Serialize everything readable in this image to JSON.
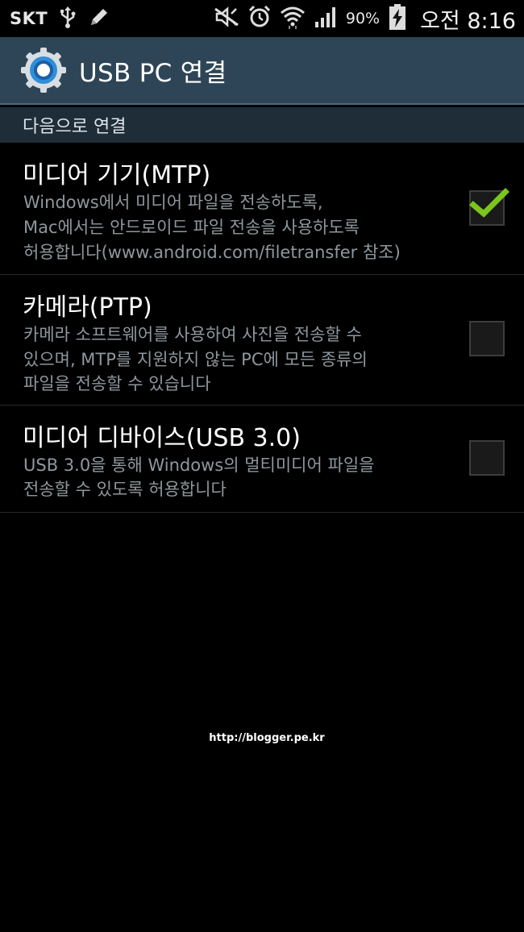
{
  "status_bar": {
    "carrier": "SKT",
    "battery_percent": "90%",
    "time": "오전 8:16",
    "icons": [
      "usb-icon",
      "pen-icon",
      "mute-icon",
      "alarm-icon",
      "wifi-icon",
      "signal-icon",
      "battery-charging-icon"
    ]
  },
  "action_bar": {
    "title": "USB PC 연결",
    "icon": "settings-gear-icon"
  },
  "section": {
    "header": "다음으로 연결"
  },
  "options": [
    {
      "title": "미디어 기기(MTP)",
      "description": [
        "Windows에서 미디어 파일을 전송하도록,",
        "Mac에서는 안드로이드 파일 전송을 사용하도록",
        "허용합니다(www.android.com/filetransfer 참조)"
      ],
      "checked": true
    },
    {
      "title": "카메라(PTP)",
      "description": [
        "카메라 소프트웨어를 사용하여 사진을 전송할 수",
        "있으며, MTP를 지원하지 않는 PC에 모든 종류의",
        "파일을 전송할 수 있습니다"
      ],
      "checked": false
    },
    {
      "title": "미디어 디바이스(USB 3.0)",
      "description": [
        "USB 3.0을 통해 Windows의 멀티미디어 파일을",
        "전송할 수 있도록 허용합니다"
      ],
      "checked": false
    }
  ],
  "watermark": "http://blogger.pe.kr",
  "colors": {
    "action_bar": "#2d4556",
    "section_header": "#1f2d38",
    "check_green": "#7bc51d",
    "secondary_text": "#8f979c"
  }
}
